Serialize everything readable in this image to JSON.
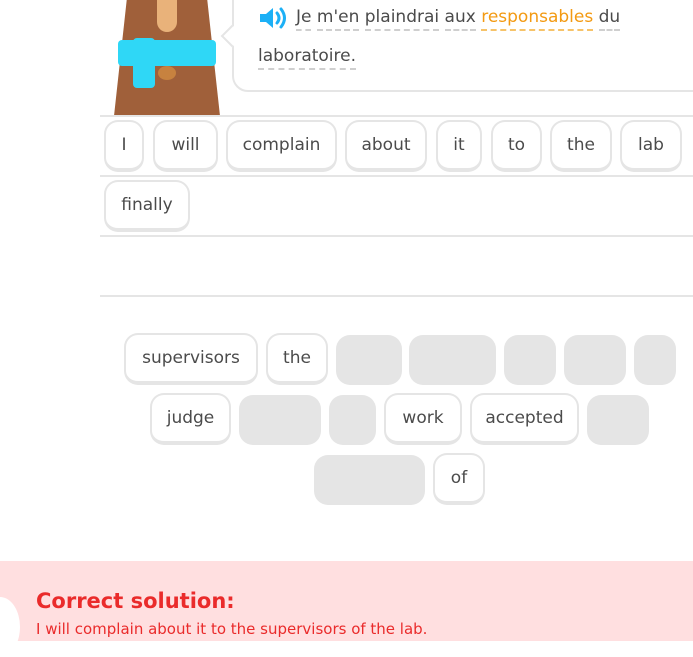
{
  "prompt": {
    "tokens": [
      "Je",
      "m'en",
      "plaindrai",
      "aux",
      "responsables",
      "du",
      "laboratoire."
    ],
    "highlight_color": "#f39a12",
    "speaker_icon": "speaker-icon"
  },
  "answer": {
    "selected_words": [
      "I",
      "will",
      "complain",
      "about",
      "it",
      "to",
      "the",
      "lab",
      "finally"
    ]
  },
  "word_bank": {
    "words": [
      "supervisors",
      "the",
      "judge",
      "work",
      "accepted",
      "of"
    ]
  },
  "feedback": {
    "title": "Correct solution:",
    "text": "I will complain about it to the supervisors of the lab.",
    "color": "#ea2b2b"
  }
}
